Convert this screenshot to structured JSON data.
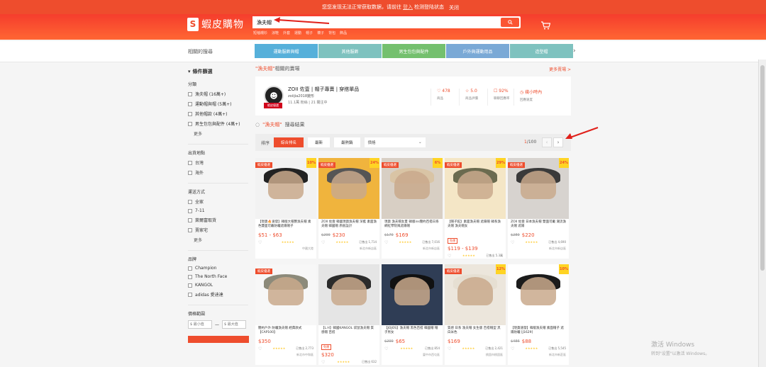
{
  "notice": {
    "text_before": "您您发现无法正常获取数据，请前往",
    "link": "登入",
    "text_after": "检测登陆状态",
    "close": "关闭"
  },
  "header": {
    "logo": "蝦皮購物",
    "search_value": "漁夫帽",
    "hints": [
      "短袖襯衫",
      "涼鞋",
      "外套",
      "運動",
      "帽子",
      "襪子",
      "背包",
      "飾品"
    ]
  },
  "categories": {
    "label": "相關的搜尋",
    "chips": [
      {
        "label": "運動服飾與帽",
        "color": "#56b0da"
      },
      {
        "label": "其他服飾",
        "color": "#7ec2bf"
      },
      {
        "label": "男生包包與配件",
        "color": "#74c06e"
      },
      {
        "label": "戶外與運動用品",
        "color": "#7aa9d6"
      },
      {
        "label": "造型帽",
        "color": "#7ec2bf"
      }
    ]
  },
  "sidebar": {
    "title": "條件篩選",
    "sections": [
      {
        "heading": "分類",
        "options": [
          "漁夫帽 (16萬+)",
          "運動帽與帽 (5萬+)",
          "其他帽款 (4萬+)",
          "男生包包與配件 (4萬+)"
        ],
        "more": "更多"
      },
      {
        "heading": "出貨地點",
        "options": [
          "台灣",
          "海外"
        ],
        "more": ""
      },
      {
        "heading": "運送方式",
        "options": [
          "全家",
          "7-11",
          "萊爾富取貨",
          "賣家宅"
        ],
        "more": "更多"
      },
      {
        "heading": "品牌",
        "options": [
          "Champion",
          "The North Face",
          "KANGOL",
          "adidas 愛迪達"
        ],
        "more": ""
      }
    ],
    "price_heading": "價格範圍",
    "price_min_ph": "$ 最小值",
    "price_max_ph": "$ 最大值"
  },
  "main": {
    "shop_header_q": "\"漁夫帽\"",
    "shop_header_rest": "相關的賣場",
    "more_shops": "更多賣場 >",
    "shop": {
      "avatar_tag": "蝦皮優選",
      "name": "ZOII 佐壹 | 帽子專賣 | 穿搭單品",
      "id": "zoiijia2018變形",
      "followers": "11.1萬 粉絲 | 21 關注中",
      "stats": [
        {
          "value": "♡ 478",
          "label": "商品"
        },
        {
          "value": "☆ 5.0",
          "label": "商品評價"
        },
        {
          "value": "☐ 92%",
          "label": "聊聊回應率"
        },
        {
          "value": "◷ 幾小時內",
          "label": "回應速度"
        }
      ]
    },
    "result_q": "\"漁夫帽\"",
    "result_rest": "搜尋結果",
    "sort": {
      "label": "排序",
      "buttons": [
        "綜合排名",
        "最新",
        "最熱銷"
      ],
      "select": "價格",
      "page_current": "1",
      "page_total": "/100"
    },
    "products": [
      {
        "badge": "蝦皮優選",
        "disc": "10%",
        "title": "【現貨🔥速發】韓版大帽簷漁夫帽 素色雙面可戴防曬遮陽帽子",
        "price": "$51 - $63",
        "old": "",
        "sold": "",
        "loc": "中國大陸",
        "bg": "#f2f2f2",
        "hat": "#222",
        "free": false
      },
      {
        "badge": "蝦皮優選",
        "disc": "24%",
        "title": "ZOII 佐壹 韓國現貨漁夫帽 深藍 素面漁夫帽 韓國帽 原創設計",
        "price": "$230",
        "old": "$299",
        "sold": "已售出 1,714",
        "loc": "新北市新店區",
        "bg": "#f0b43d",
        "hat": "#555",
        "free": false
      },
      {
        "badge": "蝦皮優選",
        "disc": "6%",
        "title": "現貨 漁夫帽女夏 韓版ins簡約百搭日系網紅學院風遮陽帽",
        "price": "$169",
        "old": "$179",
        "sold": "已售出 7,016",
        "loc": "新北市新店區",
        "bg": "#d8cfc4",
        "hat": "#d9c4a5",
        "free": false
      },
      {
        "badge": "蝦皮優選",
        "disc": "29%",
        "title": "【帽子館】素面漁夫帽 遮陽帽 韓系漁夫帽 漁夫帽女",
        "price": "$119 - $139",
        "old": "",
        "sold": "已售出 5.3萬",
        "loc": "臺南市北區",
        "bg": "#f4e6c6",
        "hat": "#6b6b4f",
        "free": true
      },
      {
        "badge": "蝦皮優選",
        "disc": "24%",
        "title": "ZOII 佐壹 日本漁夫帽 雙面可戴 潮流漁夫帽 遮陽",
        "price": "$220",
        "old": "$289",
        "sold": "已售出 4,690",
        "loc": "新北市新店區",
        "bg": "#d7d3cf",
        "hat": "#3a3a3a",
        "free": false
      },
      {
        "badge": "蝦皮優選",
        "disc": "",
        "title": "簡約戶外 防曬漁夫帽 經典款式 【CAP100】",
        "price": "$350",
        "old": "",
        "sold": "已售出 2,773",
        "loc": "新北市中和區",
        "bg": "#f7f7f7",
        "hat": "#8c8a7a",
        "free": false
      },
      {
        "badge": "",
        "disc": "",
        "title": "【L.H】韓國KANGOL 袋鼠漁夫帽 質感帽 百搭",
        "price": "$320",
        "old": "",
        "sold": "已售出 632",
        "loc": "臺北市松山區",
        "bg": "#e5e5e5",
        "hat": "#2b2b2b",
        "free": true
      },
      {
        "badge": "",
        "disc": "",
        "title": "【JOJOS】漁夫帽 黑色百搭 韓國帽 帽子男女",
        "price": "$65",
        "old": "$299",
        "sold": "已售出 854",
        "loc": "臺中市西屯區",
        "bg": "#2f3d55",
        "hat": "#111",
        "free": false
      },
      {
        "badge": "蝦皮優選",
        "disc": "12%",
        "title": "質感 日系 漁夫帽 女生版 百搭帽型 黑白米色",
        "price": "$169",
        "old": "",
        "sold": "已售出 2,421",
        "loc": "桃園市桃園區",
        "bg": "#ece6dc",
        "hat": "#e6dfd2",
        "free": false
      },
      {
        "badge": "",
        "disc": "10%",
        "title": "【現貨速發】韓版漁夫帽 素面帽子 遮陽防曬 [J1629]",
        "price": "$88",
        "old": "$486",
        "sold": "已售出 5,545",
        "loc": "新北市新莊區",
        "bg": "#ffffff",
        "hat": "#1b1b1b",
        "free": false
      }
    ]
  },
  "watermark": {
    "title": "激活 Windows",
    "sub": "转到\"设置\"以激活 Windows。"
  }
}
